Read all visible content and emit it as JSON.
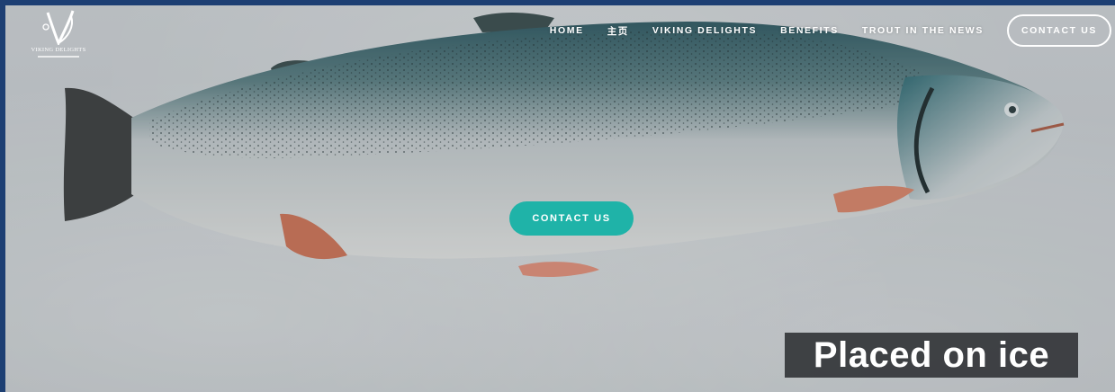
{
  "brand": {
    "name": "VIKING DELIGHTS"
  },
  "nav": {
    "items": [
      {
        "label": "HOME"
      },
      {
        "label": "主页"
      },
      {
        "label": "VIKING DELIGHTS"
      },
      {
        "label": "BENEFITS"
      },
      {
        "label": "TROUT IN THE NEWS"
      }
    ],
    "contact_label": "CONTACT US"
  },
  "hero": {
    "cta_label": "CONTACT US",
    "caption": "Placed on ice"
  },
  "colors": {
    "frame": "#1d3f73",
    "cta": "#1fb3a8",
    "caption_bg": "#282a2e"
  }
}
